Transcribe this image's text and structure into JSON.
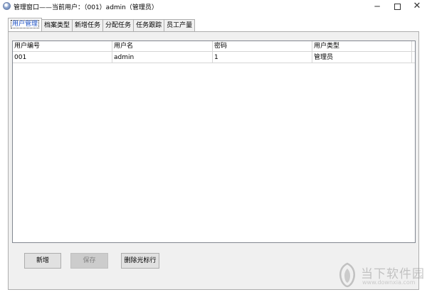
{
  "window": {
    "title": "管理窗口——当前用户：（001）admin（管理员）",
    "minimize_glyph": "─",
    "close_glyph": "✕"
  },
  "tabs": [
    {
      "label": "用户管理",
      "active": true
    },
    {
      "label": "档案类型",
      "active": false
    },
    {
      "label": "新增任务",
      "active": false
    },
    {
      "label": "分配任务",
      "active": false
    },
    {
      "label": "任务跟踪",
      "active": false
    },
    {
      "label": "员工产量",
      "active": false
    }
  ],
  "grid": {
    "columns": [
      "用户编号",
      "用户名",
      "密码",
      "用户类型"
    ],
    "rows": [
      [
        "001",
        "admin",
        "1",
        "管理员"
      ]
    ]
  },
  "buttons": {
    "add": "新增",
    "save": "保存",
    "delete": "删除光标行"
  },
  "watermark": {
    "text": "当下软件园",
    "url": "www.downxia.com"
  }
}
